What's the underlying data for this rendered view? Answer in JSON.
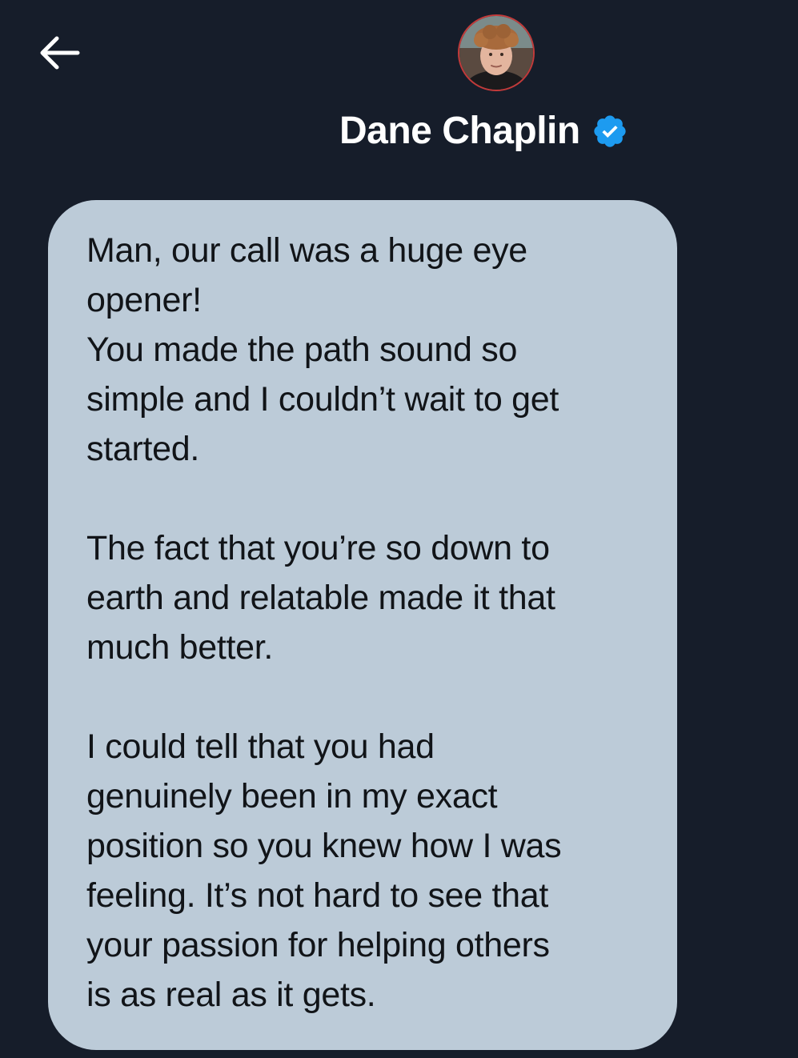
{
  "header": {
    "back_icon": "arrow-left-icon",
    "avatar_icon": "avatar",
    "name": "Dane Chaplin",
    "verified_icon": "verified-badge-icon",
    "colors": {
      "background": "#161d2a",
      "name_text": "#ffffff",
      "verified_badge": "#1d9bf0"
    }
  },
  "message": {
    "bubble_color": "#bccbd8",
    "text_color": "#111418",
    "paragraphs": [
      "Man, our call was a huge eye\nopener!\nYou made the path sound so\nsimple and I couldn’t wait to get\nstarted.",
      "The fact that you’re so down to\nearth and relatable made it that\nmuch better.",
      "I could tell that you had\ngenuinely been in my exact\nposition so you knew how I was\nfeeling. It’s not hard to see that\nyour passion for helping others\nis as real as it gets."
    ]
  }
}
